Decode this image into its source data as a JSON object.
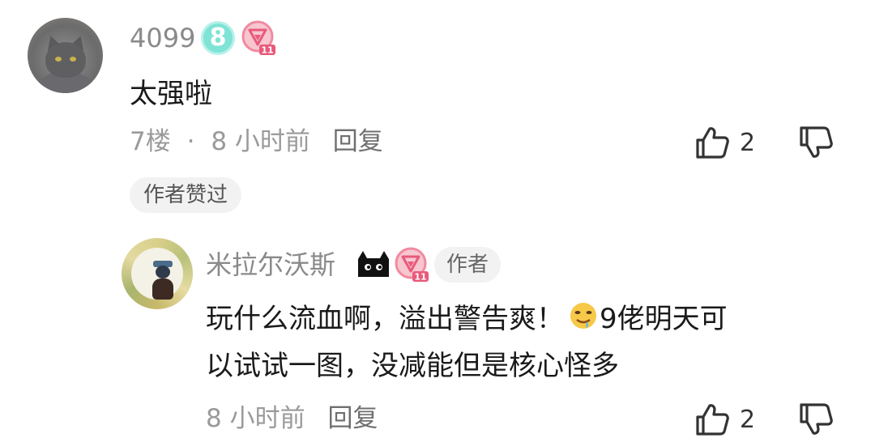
{
  "comment": {
    "username": "4099",
    "level_badge": "8",
    "vip_badge_level": "11",
    "text": "太强啦",
    "floor": "7楼",
    "separator": "·",
    "time": "8 小时前",
    "reply_label": "回复",
    "like_count": "2",
    "author_liked_label": "作者赞过"
  },
  "reply": {
    "username": "米拉尔沃斯",
    "vip_badge_level": "11",
    "author_tag": "作者",
    "text_line1": "玩什么流血啊，溢出警告爽！",
    "text_line1b": "9佬明天可",
    "text_line2": "以试试一图，没减能但是核心怪多",
    "emoji": "drooling-face-emoji",
    "time": "8 小时前",
    "reply_label": "回复",
    "like_count": "2"
  },
  "colors": {
    "username": "#8a8a8a",
    "meta": "#9a9a9a",
    "level_badge": "#7fe3d6",
    "vip_badge": "#f08aa0",
    "chip_bg": "#f2f2f2"
  },
  "icons": [
    "thumbs-up-icon",
    "thumbs-down-icon",
    "level-badge-icon",
    "vip-badge-icon",
    "black-cat-badge-icon"
  ]
}
